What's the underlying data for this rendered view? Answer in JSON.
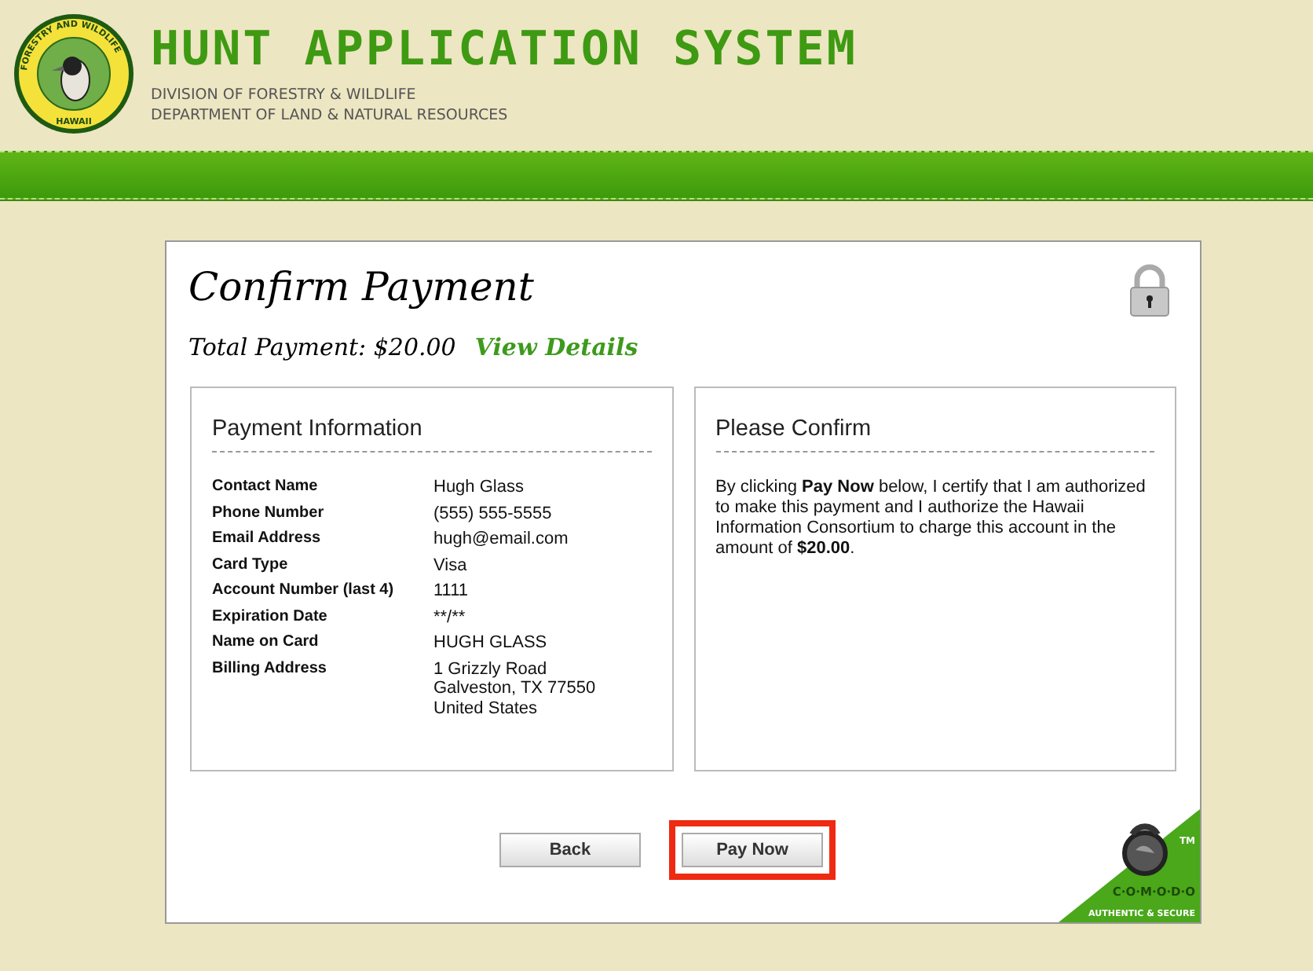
{
  "header": {
    "seal": {
      "ring_text": "FORESTRY AND WILDLIFE",
      "bottom_text": "HAWAII"
    },
    "title": "HUNT APPLICATION SYSTEM",
    "subtitle_lines": [
      "DIVISION OF FORESTRY & WILDLIFE",
      "DEPARTMENT OF LAND & NATURAL RESOURCES"
    ]
  },
  "card": {
    "title": "Confirm Payment",
    "total_label": "Total Payment: $20.00",
    "details_link": "View Details",
    "payment_info": {
      "heading": "Payment Information",
      "rows": [
        {
          "label": "Contact Name",
          "value": [
            "Hugh Glass"
          ]
        },
        {
          "label": "Phone Number",
          "value": [
            "(555) 555-5555"
          ]
        },
        {
          "label": "Email Address",
          "value": [
            "hugh@email.com"
          ]
        },
        {
          "label": "Card Type",
          "value": [
            "Visa"
          ]
        },
        {
          "label": "Account Number (last 4)",
          "value": [
            "1111"
          ]
        },
        {
          "label": "Expiration Date",
          "value": [
            "**/**"
          ]
        },
        {
          "label": "Name on Card",
          "value": [
            "HUGH GLASS"
          ]
        },
        {
          "label": "Billing Address",
          "value": [
            "1 Grizzly Road",
            "Galveston, TX 77550",
            "United States"
          ]
        }
      ]
    },
    "confirm": {
      "heading": "Please Confirm",
      "text": "By clicking **Pay Now** below, I certify that I am authorized to make this payment and I authorize the Hawaii Information Consortium to charge this account in the amount of **$20.00**."
    },
    "buttons": [
      {
        "label": "Back",
        "highlighted": false
      },
      {
        "label": "Pay Now",
        "highlighted": true
      }
    ],
    "security_badge": {
      "tm": "TM",
      "brand": "C·O·M·O·D·O",
      "tagline": "AUTHENTIC & SECURE"
    }
  }
}
